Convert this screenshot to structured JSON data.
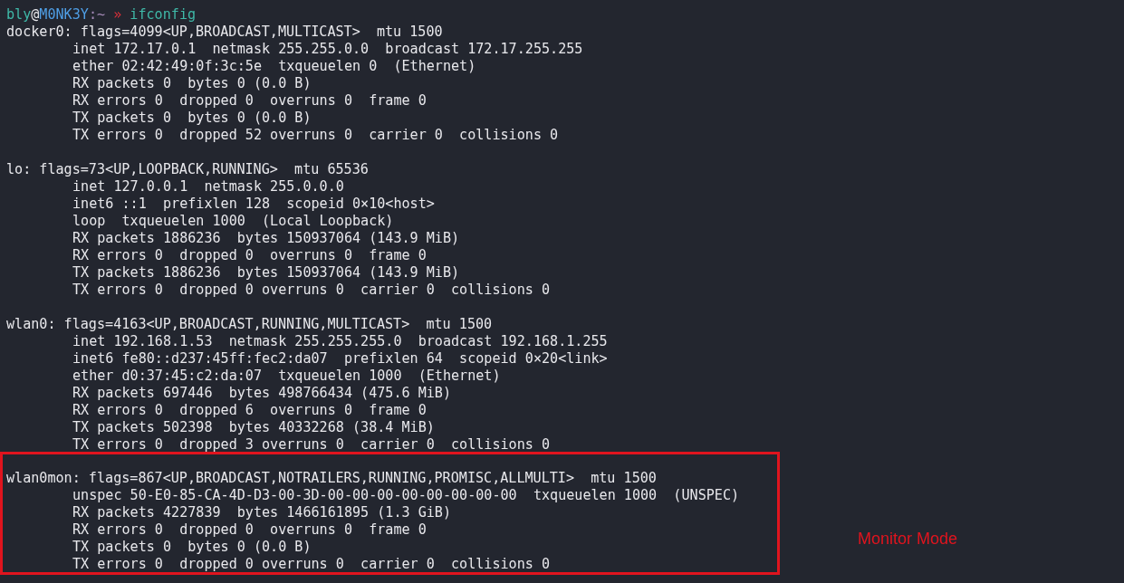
{
  "prompt": {
    "user": "bly",
    "at": "@",
    "host": "M0NK3Y",
    "path": ":~",
    "arrow": "»",
    "command": "ifconfig"
  },
  "interfaces": [
    {
      "highlighted": false,
      "header": "docker0: flags=4099<UP,BROADCAST,MULTICAST>  mtu 1500",
      "lines": [
        "inet 172.17.0.1  netmask 255.255.0.0  broadcast 172.17.255.255",
        "ether 02:42:49:0f:3c:5e  txqueuelen 0  (Ethernet)",
        "RX packets 0  bytes 0 (0.0 B)",
        "RX errors 0  dropped 0  overruns 0  frame 0",
        "TX packets 0  bytes 0 (0.0 B)",
        "TX errors 0  dropped 52 overruns 0  carrier 0  collisions 0"
      ]
    },
    {
      "highlighted": false,
      "header": "lo: flags=73<UP,LOOPBACK,RUNNING>  mtu 65536",
      "lines": [
        "inet 127.0.0.1  netmask 255.0.0.0",
        "inet6 ::1  prefixlen 128  scopeid 0×10<host>",
        "loop  txqueuelen 1000  (Local Loopback)",
        "RX packets 1886236  bytes 150937064 (143.9 MiB)",
        "RX errors 0  dropped 0  overruns 0  frame 0",
        "TX packets 1886236  bytes 150937064 (143.9 MiB)",
        "TX errors 0  dropped 0 overruns 0  carrier 0  collisions 0"
      ]
    },
    {
      "highlighted": false,
      "header": "wlan0: flags=4163<UP,BROADCAST,RUNNING,MULTICAST>  mtu 1500",
      "lines": [
        "inet 192.168.1.53  netmask 255.255.255.0  broadcast 192.168.1.255",
        "inet6 fe80::d237:45ff:fec2:da07  prefixlen 64  scopeid 0×20<link>",
        "ether d0:37:45:c2:da:07  txqueuelen 1000  (Ethernet)",
        "RX packets 697446  bytes 498766434 (475.6 MiB)",
        "RX errors 0  dropped 6  overruns 0  frame 0",
        "TX packets 502398  bytes 40332268 (38.4 MiB)",
        "TX errors 0  dropped 3 overruns 0  carrier 0  collisions 0"
      ]
    },
    {
      "highlighted": true,
      "header": "wlan0mon: flags=867<UP,BROADCAST,NOTRAILERS,RUNNING,PROMISC,ALLMULTI>  mtu 1500",
      "lines": [
        "unspec 50-E0-85-CA-4D-D3-00-3D-00-00-00-00-00-00-00-00  txqueuelen 1000  (UNSPEC)",
        "RX packets 4227839  bytes 1466161895 (1.3 GiB)",
        "RX errors 0  dropped 0  overruns 0  frame 0",
        "TX packets 0  bytes 0 (0.0 B)",
        "TX errors 0  dropped 0 overruns 0  carrier 0  collisions 0"
      ]
    }
  ],
  "annotation": "Monitor Mode"
}
